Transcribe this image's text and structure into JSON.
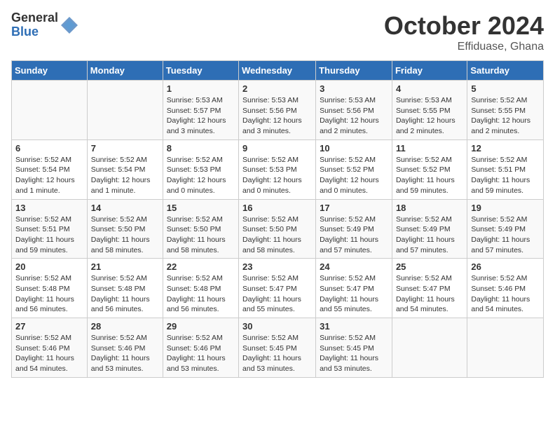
{
  "header": {
    "logo_general": "General",
    "logo_blue": "Blue",
    "month": "October 2024",
    "location": "Effiduase, Ghana"
  },
  "days_of_week": [
    "Sunday",
    "Monday",
    "Tuesday",
    "Wednesday",
    "Thursday",
    "Friday",
    "Saturday"
  ],
  "weeks": [
    [
      {
        "day": "",
        "content": ""
      },
      {
        "day": "",
        "content": ""
      },
      {
        "day": "1",
        "content": "Sunrise: 5:53 AM\nSunset: 5:57 PM\nDaylight: 12 hours\nand 3 minutes."
      },
      {
        "day": "2",
        "content": "Sunrise: 5:53 AM\nSunset: 5:56 PM\nDaylight: 12 hours\nand 3 minutes."
      },
      {
        "day": "3",
        "content": "Sunrise: 5:53 AM\nSunset: 5:56 PM\nDaylight: 12 hours\nand 2 minutes."
      },
      {
        "day": "4",
        "content": "Sunrise: 5:53 AM\nSunset: 5:55 PM\nDaylight: 12 hours\nand 2 minutes."
      },
      {
        "day": "5",
        "content": "Sunrise: 5:52 AM\nSunset: 5:55 PM\nDaylight: 12 hours\nand 2 minutes."
      }
    ],
    [
      {
        "day": "6",
        "content": "Sunrise: 5:52 AM\nSunset: 5:54 PM\nDaylight: 12 hours\nand 1 minute."
      },
      {
        "day": "7",
        "content": "Sunrise: 5:52 AM\nSunset: 5:54 PM\nDaylight: 12 hours\nand 1 minute."
      },
      {
        "day": "8",
        "content": "Sunrise: 5:52 AM\nSunset: 5:53 PM\nDaylight: 12 hours\nand 0 minutes."
      },
      {
        "day": "9",
        "content": "Sunrise: 5:52 AM\nSunset: 5:53 PM\nDaylight: 12 hours\nand 0 minutes."
      },
      {
        "day": "10",
        "content": "Sunrise: 5:52 AM\nSunset: 5:52 PM\nDaylight: 12 hours\nand 0 minutes."
      },
      {
        "day": "11",
        "content": "Sunrise: 5:52 AM\nSunset: 5:52 PM\nDaylight: 11 hours\nand 59 minutes."
      },
      {
        "day": "12",
        "content": "Sunrise: 5:52 AM\nSunset: 5:51 PM\nDaylight: 11 hours\nand 59 minutes."
      }
    ],
    [
      {
        "day": "13",
        "content": "Sunrise: 5:52 AM\nSunset: 5:51 PM\nDaylight: 11 hours\nand 59 minutes."
      },
      {
        "day": "14",
        "content": "Sunrise: 5:52 AM\nSunset: 5:50 PM\nDaylight: 11 hours\nand 58 minutes."
      },
      {
        "day": "15",
        "content": "Sunrise: 5:52 AM\nSunset: 5:50 PM\nDaylight: 11 hours\nand 58 minutes."
      },
      {
        "day": "16",
        "content": "Sunrise: 5:52 AM\nSunset: 5:50 PM\nDaylight: 11 hours\nand 58 minutes."
      },
      {
        "day": "17",
        "content": "Sunrise: 5:52 AM\nSunset: 5:49 PM\nDaylight: 11 hours\nand 57 minutes."
      },
      {
        "day": "18",
        "content": "Sunrise: 5:52 AM\nSunset: 5:49 PM\nDaylight: 11 hours\nand 57 minutes."
      },
      {
        "day": "19",
        "content": "Sunrise: 5:52 AM\nSunset: 5:49 PM\nDaylight: 11 hours\nand 57 minutes."
      }
    ],
    [
      {
        "day": "20",
        "content": "Sunrise: 5:52 AM\nSunset: 5:48 PM\nDaylight: 11 hours\nand 56 minutes."
      },
      {
        "day": "21",
        "content": "Sunrise: 5:52 AM\nSunset: 5:48 PM\nDaylight: 11 hours\nand 56 minutes."
      },
      {
        "day": "22",
        "content": "Sunrise: 5:52 AM\nSunset: 5:48 PM\nDaylight: 11 hours\nand 56 minutes."
      },
      {
        "day": "23",
        "content": "Sunrise: 5:52 AM\nSunset: 5:47 PM\nDaylight: 11 hours\nand 55 minutes."
      },
      {
        "day": "24",
        "content": "Sunrise: 5:52 AM\nSunset: 5:47 PM\nDaylight: 11 hours\nand 55 minutes."
      },
      {
        "day": "25",
        "content": "Sunrise: 5:52 AM\nSunset: 5:47 PM\nDaylight: 11 hours\nand 54 minutes."
      },
      {
        "day": "26",
        "content": "Sunrise: 5:52 AM\nSunset: 5:46 PM\nDaylight: 11 hours\nand 54 minutes."
      }
    ],
    [
      {
        "day": "27",
        "content": "Sunrise: 5:52 AM\nSunset: 5:46 PM\nDaylight: 11 hours\nand 54 minutes."
      },
      {
        "day": "28",
        "content": "Sunrise: 5:52 AM\nSunset: 5:46 PM\nDaylight: 11 hours\nand 53 minutes."
      },
      {
        "day": "29",
        "content": "Sunrise: 5:52 AM\nSunset: 5:46 PM\nDaylight: 11 hours\nand 53 minutes."
      },
      {
        "day": "30",
        "content": "Sunrise: 5:52 AM\nSunset: 5:45 PM\nDaylight: 11 hours\nand 53 minutes."
      },
      {
        "day": "31",
        "content": "Sunrise: 5:52 AM\nSunset: 5:45 PM\nDaylight: 11 hours\nand 53 minutes."
      },
      {
        "day": "",
        "content": ""
      },
      {
        "day": "",
        "content": ""
      }
    ]
  ]
}
